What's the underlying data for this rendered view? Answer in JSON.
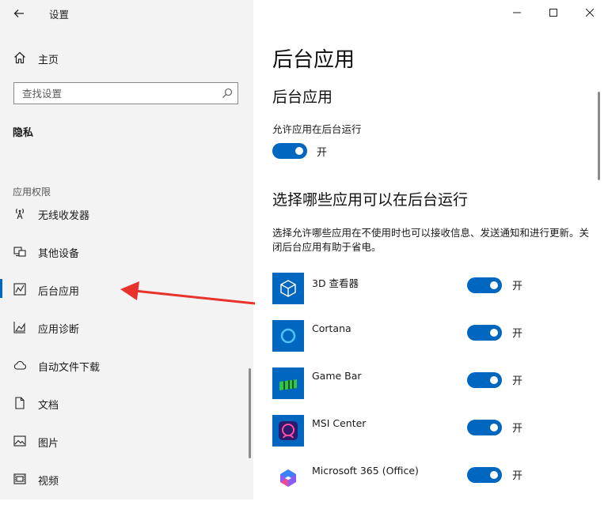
{
  "window": {
    "title": "设置"
  },
  "sidebar": {
    "home_label": "主页",
    "search_placeholder": "查找设置",
    "section_title": "隐私",
    "group_label": "应用权限",
    "items": [
      {
        "label": "无线收发器",
        "icon": "radio-tower-icon"
      },
      {
        "label": "其他设备",
        "icon": "other-devices-icon"
      },
      {
        "label": "后台应用",
        "icon": "background-apps-icon",
        "active": true
      },
      {
        "label": "应用诊断",
        "icon": "app-diagnostics-icon"
      },
      {
        "label": "自动文件下载",
        "icon": "cloud-icon"
      },
      {
        "label": "文档",
        "icon": "document-icon"
      },
      {
        "label": "图片",
        "icon": "picture-icon"
      },
      {
        "label": "视频",
        "icon": "video-icon"
      }
    ]
  },
  "main": {
    "page_title": "后台应用",
    "sub_title": "后台应用",
    "allow_label": "允许应用在后台运行",
    "allow_toggle_text": "开",
    "choose_title": "选择哪些应用可以在后台运行",
    "description": "选择允许哪些应用在不使用时也可以接收信息、发送通知和进行更新。关闭后台应用有助于省电。",
    "apps": [
      {
        "name": "3D 查看器",
        "toggle_text": "开",
        "on": true,
        "tile_color": "#0067c0"
      },
      {
        "name": "Cortana",
        "toggle_text": "开",
        "on": true,
        "tile_color": "#0067c0"
      },
      {
        "name": "Game Bar",
        "toggle_text": "开",
        "on": true,
        "tile_color": "#0067c0"
      },
      {
        "name": "MSI Center",
        "toggle_text": "开",
        "on": true,
        "tile_color": "#0067c0"
      },
      {
        "name": "Microsoft 365 (Office)",
        "toggle_text": "开",
        "on": true,
        "tile_color": "#ffffff"
      }
    ]
  },
  "colors": {
    "accent": "#0067c0",
    "sidebar_bg": "#f3f3f3",
    "arrow": "#e8322b"
  }
}
